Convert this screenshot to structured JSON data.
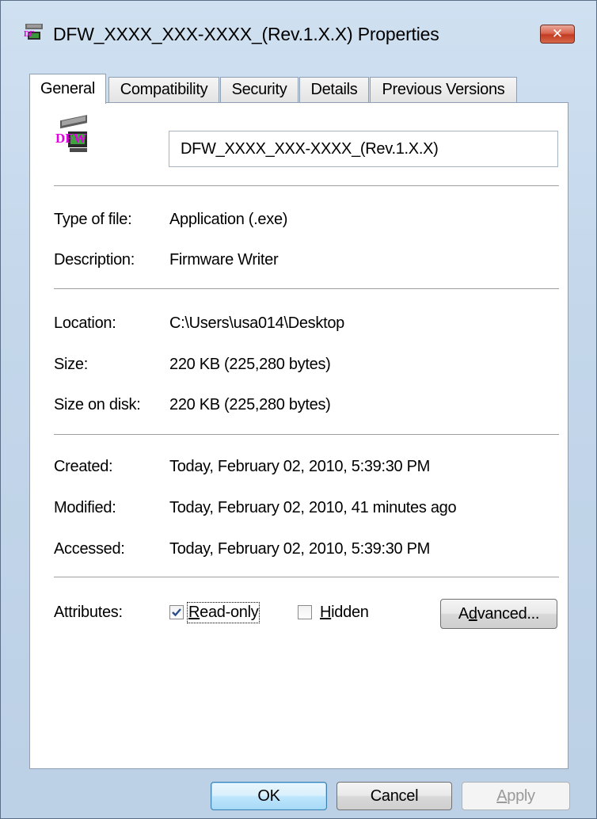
{
  "window": {
    "title": "DFW_XXXX_XXX-XXXX_(Rev.1.X.X) Properties",
    "close_label": "✕",
    "icon": "app-icon"
  },
  "tabs": [
    {
      "label": "General",
      "active": true
    },
    {
      "label": "Compatibility",
      "active": false
    },
    {
      "label": "Security",
      "active": false
    },
    {
      "label": "Details",
      "active": false
    },
    {
      "label": "Previous Versions",
      "active": false
    }
  ],
  "general": {
    "file_icon": "dfw-application-icon",
    "file_icon_text": "DFW",
    "file_name": "DFW_XXXX_XXX-XXXX_(Rev.1.X.X)",
    "type_label": "Type of file:",
    "type_value": "Application (.exe)",
    "description_label": "Description:",
    "description_value": "Firmware Writer",
    "location_label": "Location:",
    "location_value": "C:\\Users\\usa014\\Desktop",
    "size_label": "Size:",
    "size_value": "220 KB (225,280 bytes)",
    "size_on_disk_label": "Size on disk:",
    "size_on_disk_value": "220 KB (225,280 bytes)",
    "created_label": "Created:",
    "created_value": "Today, February 02, 2010, 5:39:30 PM",
    "modified_label": "Modified:",
    "modified_value": "Today, February 02, 2010, 41 minutes ago",
    "accessed_label": "Accessed:",
    "accessed_value": "Today, February 02, 2010, 5:39:30 PM",
    "attributes_label": "Attributes:",
    "read_only": {
      "label_accel": "R",
      "label_rest": "ead-only",
      "checked": true
    },
    "hidden": {
      "label_accel": "H",
      "label_rest": "idden",
      "checked": false
    },
    "advanced": {
      "label_pre": "A",
      "label_accel": "d",
      "label_rest": "vanced..."
    }
  },
  "buttons": {
    "ok": "OK",
    "cancel": "Cancel",
    "apply_accel": "A",
    "apply_rest": "pply"
  }
}
